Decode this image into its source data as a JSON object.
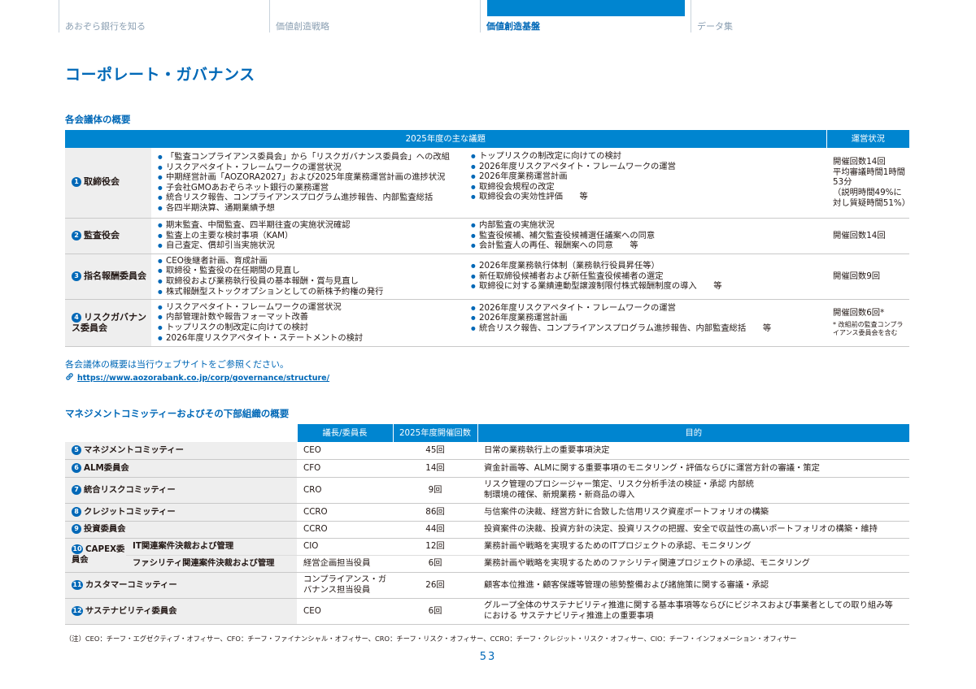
{
  "nav": {
    "tabs": [
      "あおぞら銀行を知る",
      "価値創造戦略",
      "価値創造基盤",
      "データ集"
    ]
  },
  "page_title": "コーポレート・ガバナンス",
  "section1": {
    "title": "各会議体の概要",
    "header_agenda": "2025年度の主な議題",
    "header_status": "運営状況",
    "rows": [
      {
        "num": "1",
        "name": "取締役会",
        "left": [
          "「監査コンプライアンス委員会」から「リスクガバナンス委員会」への改組",
          "リスクアペタイト・フレームワークの運営状況",
          "中期経営計画「AOZORA2027」および2025年度業務運営計画の進捗状況",
          "子会社GMOあおぞらネット銀行の業務運営",
          "統合リスク報告、コンプライアンスプログラム進捗報告、内部監査総括",
          "各四半期決算、通期業績予想"
        ],
        "right": [
          "トップリスクの制改定に向けての検討",
          "2026年度リスクアペタイト・フレームワークの運営",
          "2026年度業務運営計画",
          "取締役会規程の改定",
          "取締役会の実効性評価　　等"
        ],
        "status": [
          "開催回数14回",
          "平均審議時間1時間53分",
          "（説明時間49%に対し質疑時間51%）"
        ],
        "note": ""
      },
      {
        "num": "2",
        "name": "監査役会",
        "left": [
          "期末監査、中間監査、四半期往査の実施状況確認",
          "監査上の主要な検討事項（KAM）",
          "自己査定、償却引当実施状況"
        ],
        "right": [
          "内部監査の実施状況",
          "監査役候補、補欠監査役候補選任議案への同意",
          "会計監査人の再任、報酬案への同意　　等"
        ],
        "status": [
          "開催回数14回"
        ],
        "note": ""
      },
      {
        "num": "3",
        "name": "指名報酬委員会",
        "left": [
          "CEO後継者計画、育成計画",
          "取締役・監査役の在任期間の見直し",
          "取締役および業務執行役員の基本報酬・賞与見直し",
          "株式報酬型ストックオプションとしての新株予約権の発行"
        ],
        "right": [
          "2026年度業務執行体制（業務執行役員昇任等）",
          "新任取締役候補者および新任監査役候補者の選定",
          "取締役に対する業績連動型譲渡制限付株式報酬制度の導入　　等"
        ],
        "status": [
          "開催回数9回"
        ],
        "note": ""
      },
      {
        "num": "4",
        "name": "リスクガバナンス委員会",
        "left": [
          "リスクアペタイト・フレームワークの運営状況",
          "内部管理計数や報告フォーマット改善",
          "トップリスクの制改定に向けての検討",
          "2026年度リスクアペタイト・ステートメントの検討"
        ],
        "right": [
          "2026年度リスクアペタイト・フレームワークの運営",
          "2026年度業務運営計画",
          "統合リスク報告、コンプライアンスプログラム進捗報告、内部監査総括　　等"
        ],
        "status": [
          "開催回数6回*"
        ],
        "note": "* 改組前の監査コンプライアンス委員会を含む"
      }
    ],
    "see_website": "各会議体の概要は当行ウェブサイトをご参照ください。",
    "url": "https://www.aozorabank.co.jp/corp/governance/structure/"
  },
  "section2": {
    "title": "マネジメントコミッティーおよびその下部組織の概要",
    "headers": [
      "議長/委員長",
      "2025年度開催回数",
      "目的"
    ],
    "rows": [
      {
        "num": "5",
        "name": "マネジメントコミッティー",
        "chair": "CEO",
        "count": "45回",
        "purpose": "日常の業務執行上の重要事項決定"
      },
      {
        "num": "6",
        "name": "ALM委員会",
        "chair": "CFO",
        "count": "14回",
        "purpose": "資金計画等、ALMに関する重要事項のモニタリング・評価ならびに運営方針の審議・策定"
      },
      {
        "num": "7",
        "name": "統合リスクコミッティー",
        "chair": "CRO",
        "count": "9回",
        "purpose": "リスク管理のプロシージャー策定、リスク分析手法の検証・承認 内部統制環境の確保、新規業務・新商品の導入"
      },
      {
        "num": "8",
        "name": "クレジットコミッティー",
        "chair": "CCRO",
        "count": "86回",
        "purpose": "与信案件の決裁、経営方針に合致した信用リスク資産ポートフォリオの構築"
      },
      {
        "num": "9",
        "name": "投資委員会",
        "chair": "CCRO",
        "count": "44回",
        "purpose": "投資案件の決裁、投資方針の決定、投資リスクの把握、安全で収益性の高いポートフォリオの構築・維持"
      }
    ],
    "capex": {
      "num": "10",
      "name": "CAPEX委員会",
      "subs": [
        {
          "name": "IT関連案件決裁および管理",
          "chair": "CIO",
          "count": "12回",
          "purpose": "業務計画や戦略を実現するためのITプロジェクトの承認、モニタリング"
        },
        {
          "name": "ファシリティ関連案件決裁および管理",
          "chair": "経営企画担当役員",
          "count": "6回",
          "purpose": "業務計画や戦略を実現するためのファシリティ関連プロジェクトの承認、モニタリング"
        }
      ]
    },
    "rows_after": [
      {
        "num": "11",
        "name": "カスタマーコミッティー",
        "chair": "コンプライアンス・ガバナンス担当役員",
        "count": "26回",
        "purpose": "顧客本位推進・顧客保護等管理の態勢整備および諸施策に関する審議・承認"
      },
      {
        "num": "12",
        "name": "サステナビリティ委員会",
        "chair": "CEO",
        "count": "6回",
        "purpose": "グループ全体のサステナビリティ推進に関する基本事項等ならびにビジネスおよび事業者としての取り組み等における サステナビリティ推進上の重要事項"
      }
    ]
  },
  "footnote": "（注）CEO：チーフ・エグゼクティブ・オフィサー、CFO：チーフ・ファイナンシャル・オフィサー、CRO：チーフ・リスク・オフィサー、CCRO：チーフ・クレジット・リスク・オフィサー、CIO：チーフ・インフォメーション・オフィサー",
  "page_number": "53"
}
